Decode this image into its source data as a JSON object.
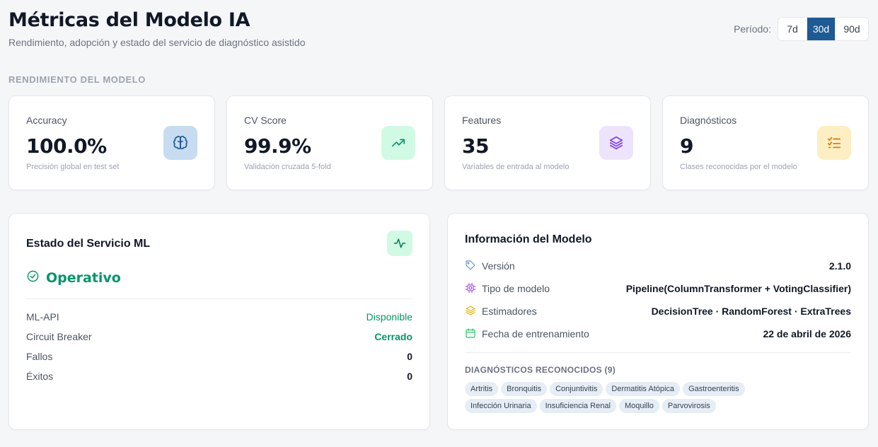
{
  "header": {
    "title": "Métricas del Modelo IA",
    "subtitle": "Rendimiento, adopción y estado del servicio de diagnóstico asistido",
    "period_label": "Período:",
    "period_options": [
      "7d",
      "30d",
      "90d"
    ],
    "period_selected": "30d"
  },
  "section_label": "RENDIMIENTO DEL MODELO",
  "kpis": [
    {
      "label": "Accuracy",
      "value": "100.0%",
      "desc": "Precisión global en test set",
      "icon": "brain-icon",
      "bg": "#c7dcf0",
      "color": "#1e5a93"
    },
    {
      "label": "CV Score",
      "value": "99.9%",
      "desc": "Validación cruzada 5-fold",
      "icon": "trending-up-icon",
      "bg": "#d1fae5",
      "color": "#059669"
    },
    {
      "label": "Features",
      "value": "35",
      "desc": "Variables de entrada al modelo",
      "icon": "layers-icon",
      "bg": "#ede4fb",
      "color": "#7c3aed"
    },
    {
      "label": "Diagnósticos",
      "value": "9",
      "desc": "Clases reconocidas por el modelo",
      "icon": "list-checks-icon",
      "bg": "#fdefc3",
      "color": "#d97706"
    }
  ],
  "service": {
    "title": "Estado del Servicio ML",
    "status": "Operativo",
    "rows": [
      {
        "label": "ML-API",
        "value": "Disponible"
      },
      {
        "label": "Circuit Breaker",
        "value": "Cerrado"
      },
      {
        "label": "Fallos",
        "value": "0"
      },
      {
        "label": "Éxitos",
        "value": "0"
      }
    ]
  },
  "model_info": {
    "title": "Información del Modelo",
    "rows": [
      {
        "label": "Versión",
        "value": "2.1.0",
        "icon": "tag-icon"
      },
      {
        "label": "Tipo de modelo",
        "value": "Pipeline(ColumnTransformer + VotingClassifier)",
        "icon": "cpu-icon"
      },
      {
        "label": "Estimadores",
        "value": "DecisionTree · RandomForest · ExtraTrees",
        "icon": "layers-icon"
      },
      {
        "label": "Fecha de entrenamiento",
        "value": "22 de abril de 2026",
        "icon": "calendar-icon"
      }
    ],
    "diagnoses_label": "DIAGNÓSTICOS RECONOCIDOS (9)",
    "diagnoses": [
      "Artritis",
      "Bronquitis",
      "Conjuntivitis",
      "Dermatitis Atópica",
      "Gastroenteritis",
      "Infección Urinaria",
      "Insuficiencia Renal",
      "Moquillo",
      "Parvovirosis"
    ]
  }
}
